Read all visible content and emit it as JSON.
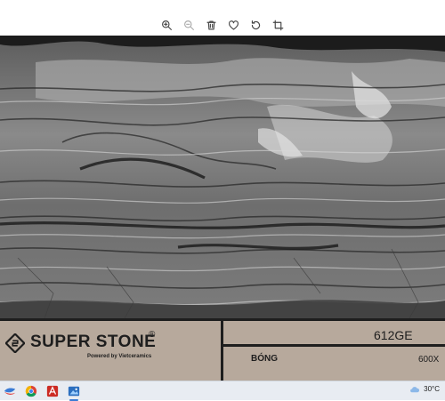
{
  "toolbar": {
    "buttons": [
      {
        "name": "zoom-in",
        "enabled": true
      },
      {
        "name": "zoom-out",
        "enabled": false
      },
      {
        "name": "delete",
        "enabled": true
      },
      {
        "name": "favorite",
        "enabled": true
      },
      {
        "name": "rotate",
        "enabled": true
      },
      {
        "name": "crop",
        "enabled": true
      }
    ]
  },
  "tile": {
    "brand": "SUPER STONE",
    "registered": "®",
    "tagline": "Powered by Vietceramics",
    "code": "612GE",
    "finish": "BÓNG",
    "size": "600X",
    "label_color": "#b7a99c"
  },
  "taskbar": {
    "apps": [
      "windows-start",
      "chrome",
      "acrobat",
      "photos"
    ],
    "weather": "30°C"
  }
}
